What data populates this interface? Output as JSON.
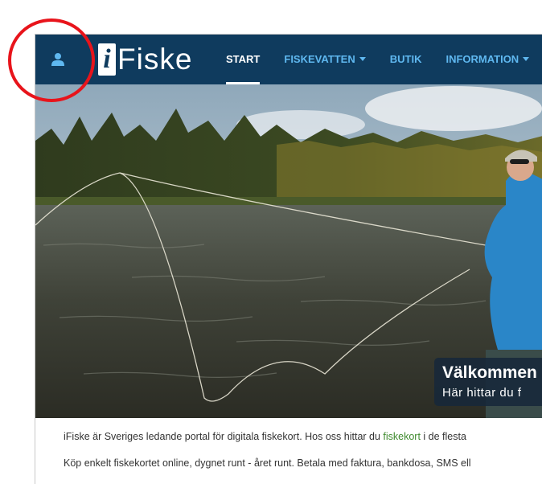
{
  "nav": {
    "logo_letter": "i",
    "logo_text": "Fiske",
    "items": [
      {
        "label": "START",
        "active": true,
        "dropdown": false
      },
      {
        "label": "FISKEVATTEN",
        "active": false,
        "dropdown": true
      },
      {
        "label": "BUTIK",
        "active": false,
        "dropdown": false
      },
      {
        "label": "INFORMATION",
        "active": false,
        "dropdown": true
      }
    ],
    "user_icon": "user-icon",
    "background_color": "#0f3b5e",
    "link_color": "#5fb8f0"
  },
  "hero": {
    "title": "Välkommen",
    "subtitle": "Här hittar du f"
  },
  "content": {
    "p1_before": "iFiske är Sveriges ledande portal för digitala fiskekort. Hos oss hittar du ",
    "p1_link": "fiskekort",
    "p1_after": " i de flesta",
    "p2": "Köp enkelt fiskekortet online, dygnet runt - året runt. Betala med faktura, bankdosa, SMS ell",
    "link_color": "#3f8a2e"
  },
  "annotation": {
    "color": "#e8141b"
  }
}
